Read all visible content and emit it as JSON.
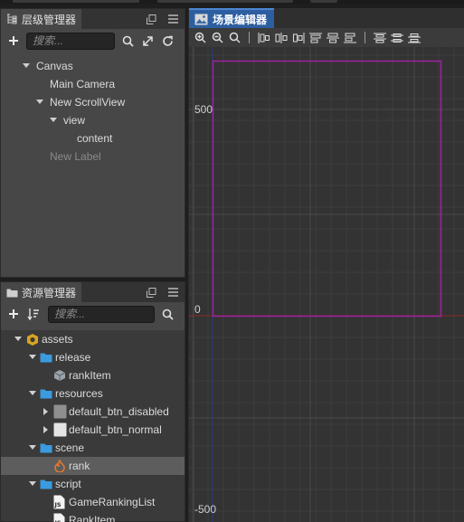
{
  "hierarchy": {
    "title": "层级管理器",
    "search_placeholder": "搜索...",
    "nodes": [
      {
        "label": "Canvas",
        "depth": 0,
        "arrow": "down",
        "dim": false
      },
      {
        "label": "Main Camera",
        "depth": 1,
        "arrow": "",
        "dim": false
      },
      {
        "label": "New ScrollView",
        "depth": 1,
        "arrow": "down",
        "dim": false
      },
      {
        "label": "view",
        "depth": 2,
        "arrow": "down",
        "dim": false
      },
      {
        "label": "content",
        "depth": 3,
        "arrow": "",
        "dim": false
      },
      {
        "label": "New Label",
        "depth": 1,
        "arrow": "",
        "dim": true
      }
    ]
  },
  "assets": {
    "title": "资源管理器",
    "search_placeholder": "搜索...",
    "items": [
      {
        "label": "assets",
        "depth": 0,
        "arrow": "down",
        "icon": "assets-db-icon",
        "selected": false
      },
      {
        "label": "release",
        "depth": 1,
        "arrow": "down",
        "icon": "folder-icon",
        "selected": false
      },
      {
        "label": "rankItem",
        "depth": 2,
        "arrow": "",
        "icon": "prefab-icon",
        "selected": false
      },
      {
        "label": "resources",
        "depth": 1,
        "arrow": "down",
        "icon": "folder-icon",
        "selected": false
      },
      {
        "label": "default_btn_disabled",
        "depth": 2,
        "arrow": "right",
        "icon": "texture-gray-icon",
        "selected": false
      },
      {
        "label": "default_btn_normal",
        "depth": 2,
        "arrow": "right",
        "icon": "texture-white-icon",
        "selected": false
      },
      {
        "label": "scene",
        "depth": 1,
        "arrow": "down",
        "icon": "folder-icon",
        "selected": false
      },
      {
        "label": "rank",
        "depth": 2,
        "arrow": "",
        "icon": "fire-scene-icon",
        "selected": true
      },
      {
        "label": "script",
        "depth": 1,
        "arrow": "down",
        "icon": "folder-icon",
        "selected": false
      },
      {
        "label": "GameRankingList",
        "depth": 2,
        "arrow": "",
        "icon": "js-file-icon",
        "selected": false
      },
      {
        "label": "RankItem",
        "depth": 2,
        "arrow": "",
        "icon": "js-file-icon",
        "selected": false
      }
    ]
  },
  "scene": {
    "title": "场景编辑器",
    "axis_labels": {
      "top": "500",
      "zero": "0",
      "bottom": "-500"
    },
    "colors": {
      "canvas_frame": "#a020a0",
      "x_axis": "#8a2a2a",
      "y_axis": "#2a3a8a",
      "tab_active": "#2d5ea0"
    }
  }
}
